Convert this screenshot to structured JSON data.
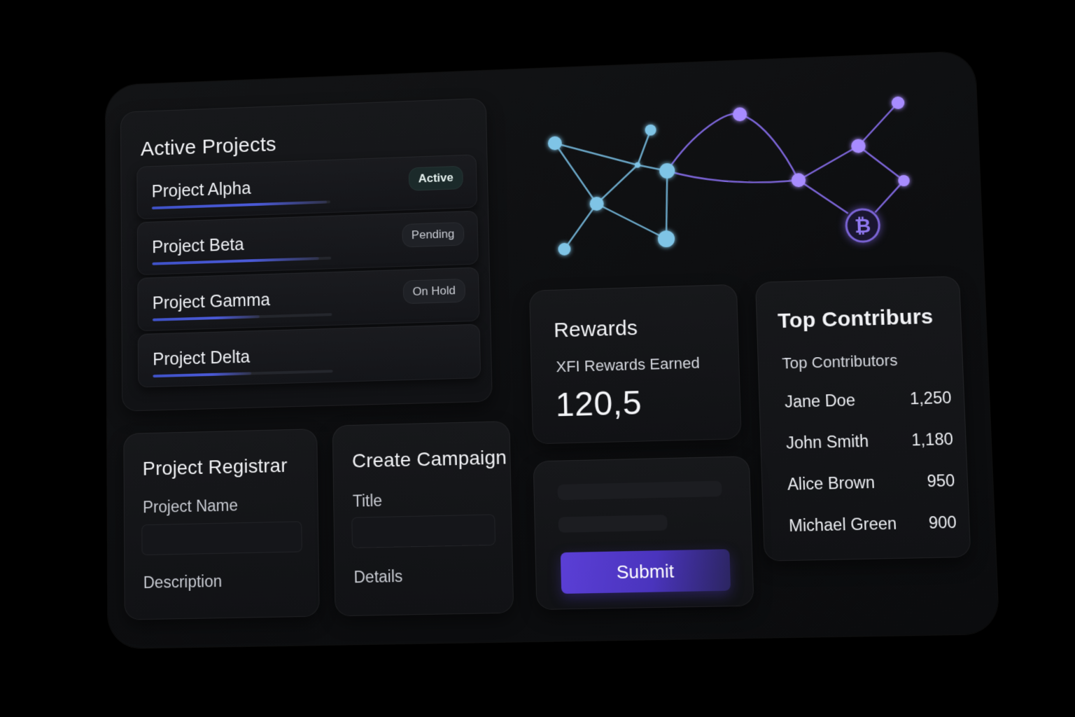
{
  "active_projects": {
    "title": "Active Projects",
    "projects": [
      {
        "name": "Project Alpha",
        "status": "Active",
        "progress": 0.98
      },
      {
        "name": "Project Beta",
        "status": "Pending",
        "progress": 0.93
      },
      {
        "name": "Project Gamma",
        "status": "On Hold",
        "progress": 0.6
      },
      {
        "name": "Project Delta",
        "status": "",
        "progress": 0.55
      }
    ]
  },
  "network": {
    "icon": "bitcoin-icon",
    "colors": {
      "teal": "#7fc4e6",
      "violet": "#a88cff",
      "line_teal": "#6aa6c6",
      "line_violet": "#7b64d6"
    }
  },
  "rewards": {
    "title": "Rewards",
    "label": "XFI Rewards Earned",
    "value": "120,5"
  },
  "top_contributors": {
    "title": "Top Contriburs",
    "subtitle": "Top Contributors",
    "rows": [
      {
        "name": "Jane Doe",
        "value": "1,250"
      },
      {
        "name": "John Smith",
        "value": "1,180"
      },
      {
        "name": "Alice Brown",
        "value": "950"
      },
      {
        "name": "Michael Green",
        "value": "900"
      }
    ]
  },
  "submit_form": {
    "button_label": "Submit",
    "accent": "#5b3fd6"
  },
  "project_registrar": {
    "title": "Project Registrar",
    "name_label": "Project Name",
    "name_value": "",
    "description_label": "Description"
  },
  "create_campaign": {
    "title": "Create Campaign",
    "title_label": "Title",
    "title_value": "",
    "details_label": "Details"
  }
}
